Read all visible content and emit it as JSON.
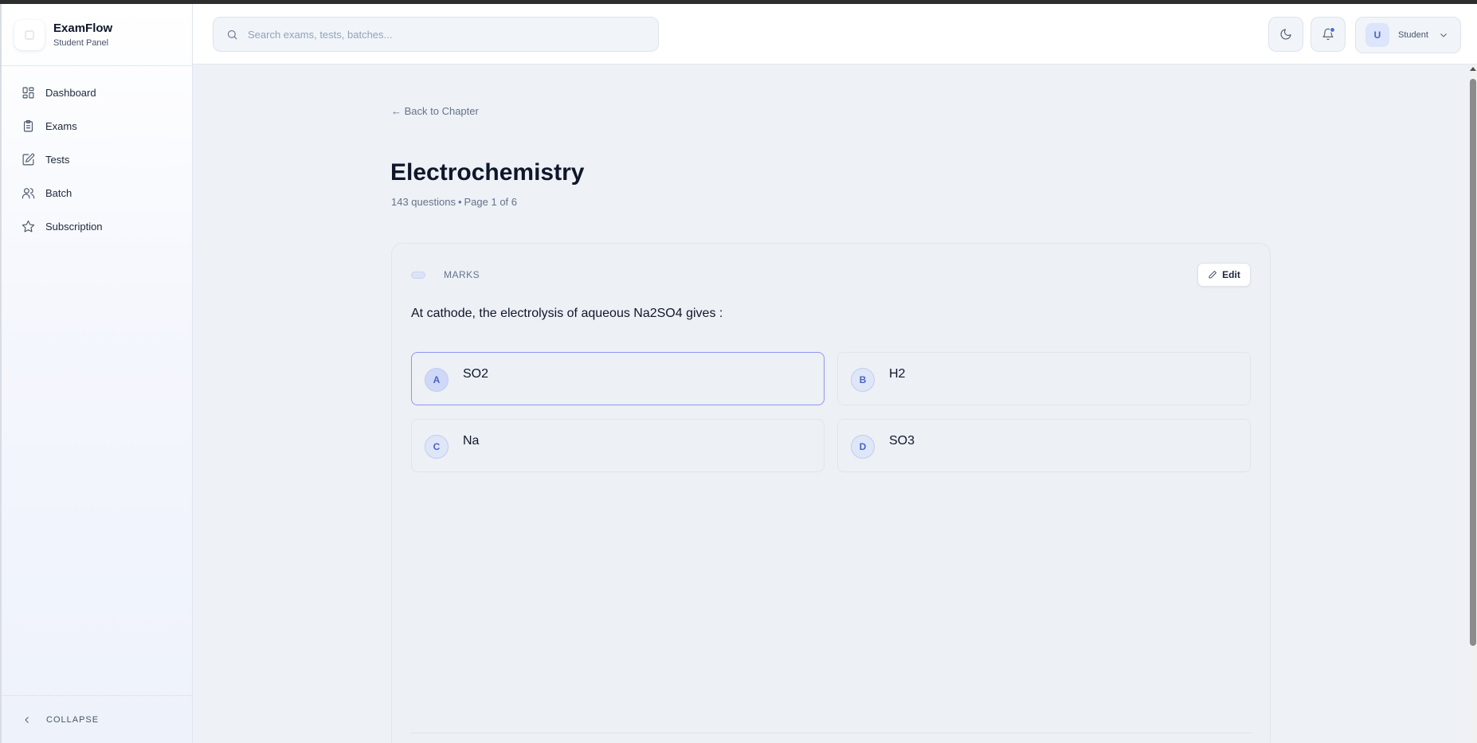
{
  "app": {
    "name": "ExamFlow",
    "panel": "Student Panel"
  },
  "sidebar": {
    "items": [
      {
        "label": "Dashboard",
        "icon": "dashboard-icon"
      },
      {
        "label": "Exams",
        "icon": "clipboard-icon"
      },
      {
        "label": "Tests",
        "icon": "edit-check-icon"
      },
      {
        "label": "Batch",
        "icon": "users-icon"
      },
      {
        "label": "Subscription",
        "icon": "star-icon"
      }
    ],
    "collapse_label": "COLLAPSE"
  },
  "header": {
    "search_placeholder": "Search exams, tests, batches...",
    "user": {
      "initial": "U",
      "role": "Student"
    },
    "has_notification": true
  },
  "main": {
    "back_label": "← Back to Chapter",
    "chapter_title": "Electrochemistry",
    "question_count": "143 questions",
    "separator": "•",
    "page_info": "Page 1 of 6",
    "question_card": {
      "marks_label": "MARKS",
      "edit_label": "Edit",
      "question_text": "At cathode, the electrolysis of aqueous Na2SO4 gives :",
      "selected_option": "A",
      "options": [
        {
          "letter": "A",
          "text": "SO2"
        },
        {
          "letter": "B",
          "text": "H2"
        },
        {
          "letter": "C",
          "text": "Na"
        },
        {
          "letter": "D",
          "text": "SO3"
        }
      ]
    }
  },
  "colors": {
    "accent": "#4b64c8",
    "selected_border": "#8f98ee",
    "background": "#eef1f6"
  }
}
